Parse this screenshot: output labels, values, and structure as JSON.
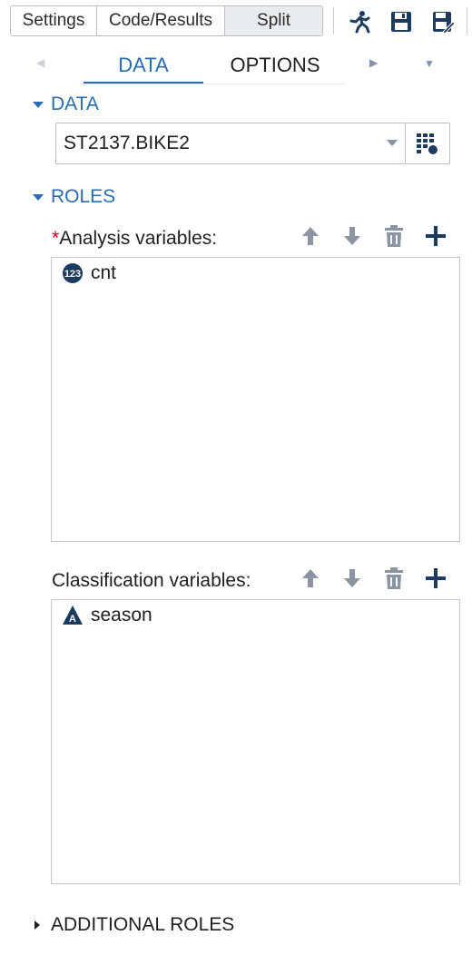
{
  "toolbar": {
    "settings_label": "Settings",
    "code_results_label": "Code/Results",
    "split_label": "Split"
  },
  "tabs": {
    "data_label": "DATA",
    "options_label": "OPTIONS"
  },
  "data_section": {
    "heading": "DATA",
    "dataset_value": "ST2137.BIKE2"
  },
  "roles_section": {
    "heading": "ROLES",
    "analysis": {
      "required_marker": "*",
      "label": "Analysis variables:",
      "items": [
        {
          "name": "cnt",
          "type_icon": "numeric-icon",
          "icon_text": "123"
        }
      ]
    },
    "classification": {
      "label": "Classification variables:",
      "items": [
        {
          "name": "season",
          "type_icon": "character-icon",
          "icon_text": "A"
        }
      ]
    }
  },
  "additional_roles": {
    "heading": "ADDITIONAL ROLES"
  },
  "colors": {
    "accent": "#2b6cb0",
    "icon_dark": "#1d3a5f",
    "icon_gray": "#8a94a3",
    "required": "#d0021b"
  }
}
